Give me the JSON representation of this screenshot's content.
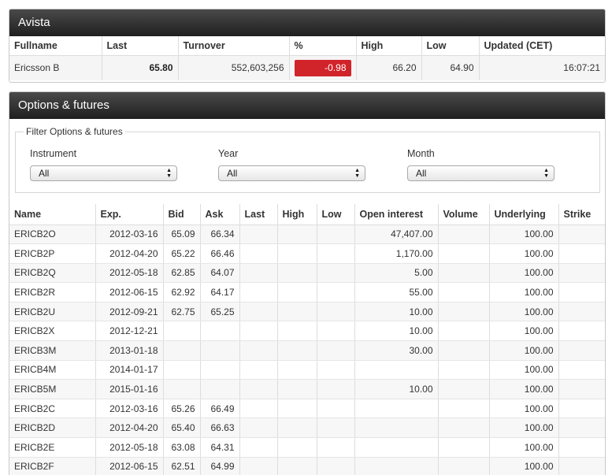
{
  "quote_panel": {
    "title": "Avista",
    "headers": {
      "fullname": "Fullname",
      "last": "Last",
      "turnover": "Turnover",
      "percent": "%",
      "high": "High",
      "low": "Low",
      "updated": "Updated (CET)"
    },
    "row": {
      "fullname": "Ericsson B",
      "last": "65.80",
      "turnover": "552,603,256",
      "percent": "-0.98",
      "high": "66.20",
      "low": "64.90",
      "updated": "16:07:21"
    },
    "colors": {
      "negative": "#d1232a"
    }
  },
  "options_panel": {
    "title": "Options & futures",
    "filter": {
      "legend": "Filter Options & futures",
      "instrument": {
        "label": "Instrument",
        "value": "All"
      },
      "year": {
        "label": "Year",
        "value": "All"
      },
      "month": {
        "label": "Month",
        "value": "All"
      }
    },
    "columns": [
      "Name",
      "Exp.",
      "Bid",
      "Ask",
      "Last",
      "High",
      "Low",
      "Open interest",
      "Volume",
      "Underlying",
      "Strike"
    ],
    "rows": [
      {
        "name": "ERICB2O",
        "exp": "2012-03-16",
        "bid": "65.09",
        "ask": "66.34",
        "last": "",
        "high": "",
        "low": "",
        "open_interest": "47,407.00",
        "volume": "",
        "underlying": "100.00",
        "strike": ""
      },
      {
        "name": "ERICB2P",
        "exp": "2012-04-20",
        "bid": "65.22",
        "ask": "66.46",
        "last": "",
        "high": "",
        "low": "",
        "open_interest": "1,170.00",
        "volume": "",
        "underlying": "100.00",
        "strike": ""
      },
      {
        "name": "ERICB2Q",
        "exp": "2012-05-18",
        "bid": "62.85",
        "ask": "64.07",
        "last": "",
        "high": "",
        "low": "",
        "open_interest": "5.00",
        "volume": "",
        "underlying": "100.00",
        "strike": ""
      },
      {
        "name": "ERICB2R",
        "exp": "2012-06-15",
        "bid": "62.92",
        "ask": "64.17",
        "last": "",
        "high": "",
        "low": "",
        "open_interest": "55.00",
        "volume": "",
        "underlying": "100.00",
        "strike": ""
      },
      {
        "name": "ERICB2U",
        "exp": "2012-09-21",
        "bid": "62.75",
        "ask": "65.25",
        "last": "",
        "high": "",
        "low": "",
        "open_interest": "10.00",
        "volume": "",
        "underlying": "100.00",
        "strike": ""
      },
      {
        "name": "ERICB2X",
        "exp": "2012-12-21",
        "bid": "",
        "ask": "",
        "last": "",
        "high": "",
        "low": "",
        "open_interest": "10.00",
        "volume": "",
        "underlying": "100.00",
        "strike": ""
      },
      {
        "name": "ERICB3M",
        "exp": "2013-01-18",
        "bid": "",
        "ask": "",
        "last": "",
        "high": "",
        "low": "",
        "open_interest": "30.00",
        "volume": "",
        "underlying": "100.00",
        "strike": ""
      },
      {
        "name": "ERICB4M",
        "exp": "2014-01-17",
        "bid": "",
        "ask": "",
        "last": "",
        "high": "",
        "low": "",
        "open_interest": "",
        "volume": "",
        "underlying": "100.00",
        "strike": ""
      },
      {
        "name": "ERICB5M",
        "exp": "2015-01-16",
        "bid": "",
        "ask": "",
        "last": "",
        "high": "",
        "low": "",
        "open_interest": "10.00",
        "volume": "",
        "underlying": "100.00",
        "strike": ""
      },
      {
        "name": "ERICB2C",
        "exp": "2012-03-16",
        "bid": "65.26",
        "ask": "66.49",
        "last": "",
        "high": "",
        "low": "",
        "open_interest": "",
        "volume": "",
        "underlying": "100.00",
        "strike": ""
      },
      {
        "name": "ERICB2D",
        "exp": "2012-04-20",
        "bid": "65.40",
        "ask": "66.63",
        "last": "",
        "high": "",
        "low": "",
        "open_interest": "",
        "volume": "",
        "underlying": "100.00",
        "strike": ""
      },
      {
        "name": "ERICB2E",
        "exp": "2012-05-18",
        "bid": "63.08",
        "ask": "64.31",
        "last": "",
        "high": "",
        "low": "",
        "open_interest": "",
        "volume": "",
        "underlying": "100.00",
        "strike": ""
      },
      {
        "name": "ERICB2F",
        "exp": "2012-06-15",
        "bid": "62.51",
        "ask": "64.99",
        "last": "",
        "high": "",
        "low": "",
        "open_interest": "",
        "volume": "",
        "underlying": "100.00",
        "strike": ""
      }
    ]
  }
}
